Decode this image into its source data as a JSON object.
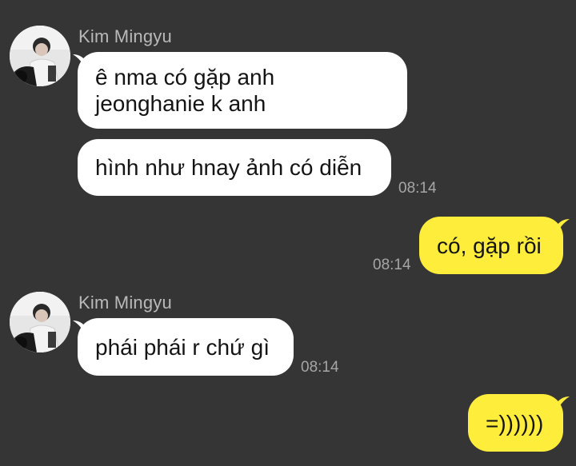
{
  "messages": [
    {
      "sender": "Kim Mingyu",
      "lines": [
        "ê nma có gặp anh\njeonghanie k anh",
        "hình như hnay ảnh có diễn"
      ],
      "time": "08:14",
      "direction": "incoming"
    },
    {
      "lines": [
        "có, gặp rồi"
      ],
      "time": "08:14",
      "direction": "outgoing"
    },
    {
      "sender": "Kim Mingyu",
      "lines": [
        "phái phái r chứ gì"
      ],
      "time": "08:14",
      "direction": "incoming"
    },
    {
      "lines": [
        "=))))))"
      ],
      "direction": "outgoing"
    }
  ],
  "colors": {
    "background": "#353535",
    "incoming_bubble": "#ffffff",
    "outgoing_bubble": "#ffed3b",
    "sender_name": "#b9b9b9",
    "timestamp": "#a6a6a6"
  }
}
